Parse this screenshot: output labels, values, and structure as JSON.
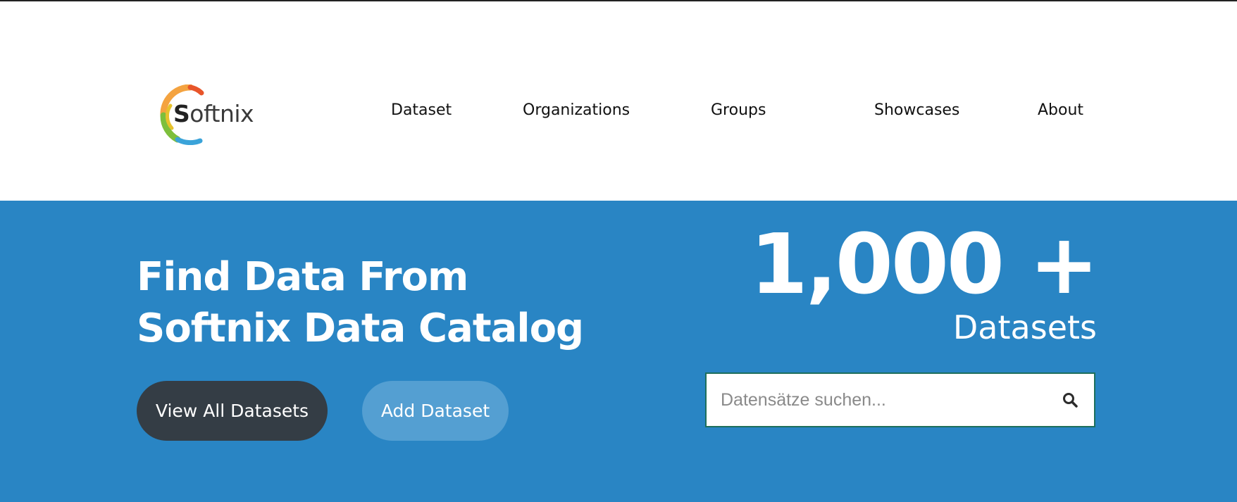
{
  "header": {
    "logo": {
      "first_letter": "S",
      "rest": "oftnix"
    },
    "nav": [
      {
        "label": "Dataset"
      },
      {
        "label": "Organizations"
      },
      {
        "label": "Groups"
      },
      {
        "label": "Showcases"
      },
      {
        "label": "About"
      }
    ]
  },
  "hero": {
    "title_line1": "Find Data From",
    "title_line2": "Softnix Data Catalog",
    "buttons": {
      "view_all": "View All Datasets",
      "add": "Add Dataset"
    },
    "stat": {
      "number": "1,000 +",
      "label": "Datasets"
    },
    "search": {
      "placeholder": "Datensätze suchen...",
      "value": "",
      "icon": "search-icon"
    }
  },
  "colors": {
    "hero_background": "#2985c4",
    "primary_button": "#343d45",
    "secondary_button": "#549fd2",
    "search_border": "#1e6f5c"
  }
}
